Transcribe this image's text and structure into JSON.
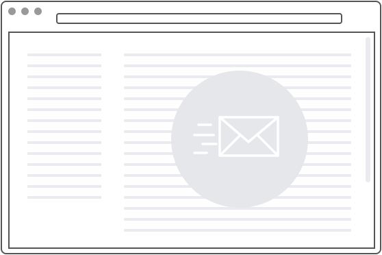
{
  "window": {
    "controls": [
      "close-dot",
      "minimize-dot",
      "maximize-dot"
    ],
    "address_bar": {
      "value": ""
    }
  },
  "page": {
    "sidebar": {
      "line_count": 14
    },
    "content": {
      "line_count": 17
    },
    "overlay": {
      "icon": "email-sending-icon"
    }
  },
  "colors": {
    "frame": "#555555",
    "window_dot": "#999999",
    "placeholder_line": "#ebebef",
    "overlay_circle": "#e6e7eb",
    "icon": "#ffffff"
  }
}
